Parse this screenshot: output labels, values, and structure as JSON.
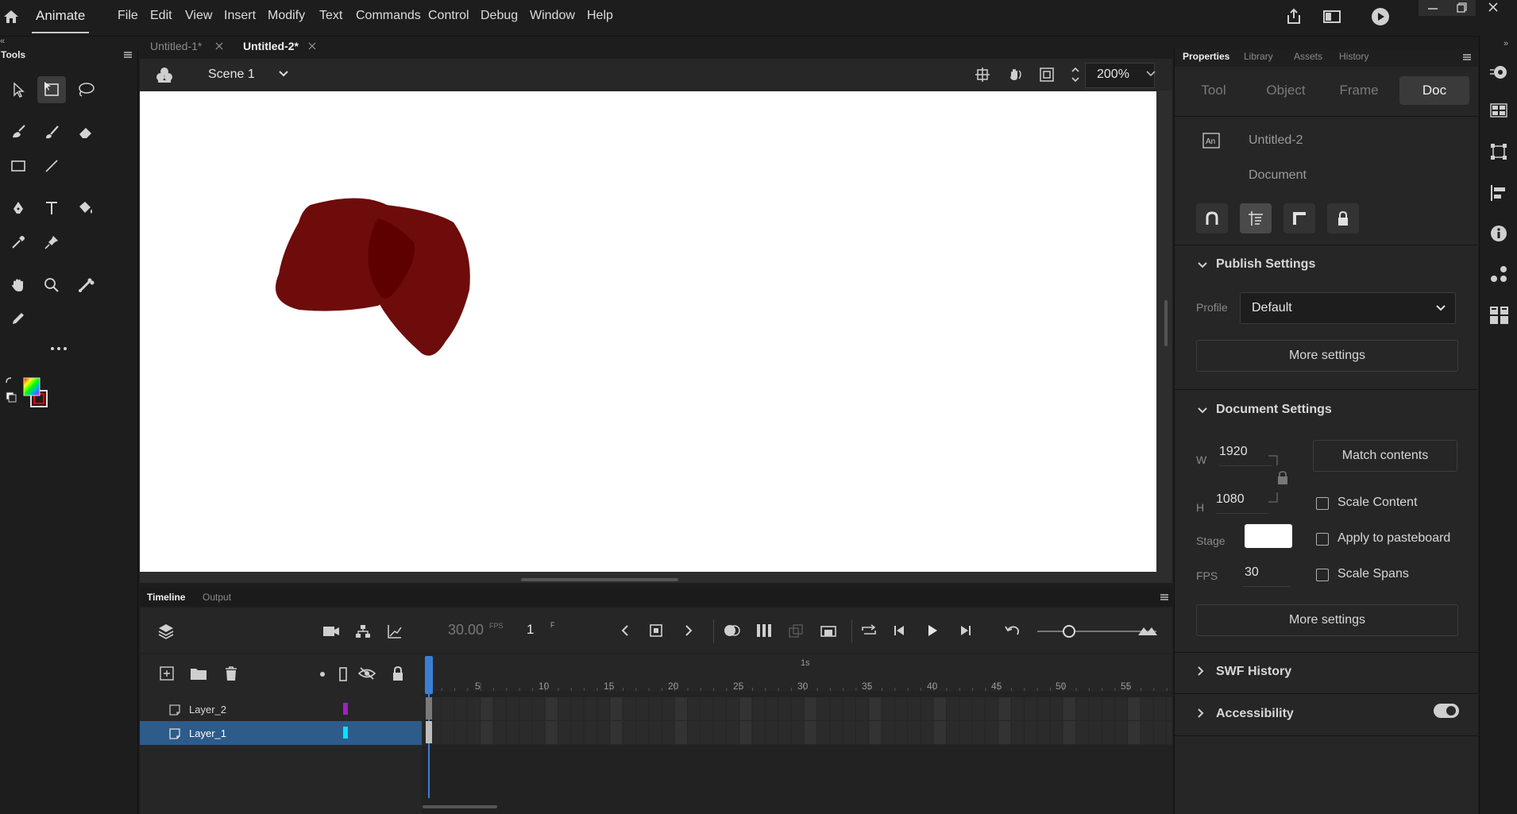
{
  "app": {
    "name": "Animate"
  },
  "menu": [
    "File",
    "Edit",
    "View",
    "Insert",
    "Modify",
    "Text",
    "Commands",
    "Control",
    "Debug",
    "Window",
    "Help"
  ],
  "doc_tabs": [
    {
      "label": "Untitled-1*",
      "active": false
    },
    {
      "label": "Untitled-2*",
      "active": true
    }
  ],
  "tools_panel": {
    "title": "Tools"
  },
  "scene": {
    "label": "Scene 1",
    "zoom": "200%"
  },
  "timeline": {
    "tabs": [
      "Timeline",
      "Output"
    ],
    "fps_value": "30.00",
    "fps_unit": "FPS",
    "frame_value": "1",
    "frame_unit": "F",
    "ruler_second": "1s",
    "ruler_ticks": [
      "5",
      "10",
      "15",
      "20",
      "25",
      "30",
      "35",
      "40",
      "45",
      "50",
      "55"
    ],
    "layers": [
      {
        "name": "Layer_2",
        "color": "#a020c0",
        "selected": false
      },
      {
        "name": "Layer_1",
        "color": "#00e5ff",
        "selected": true
      }
    ]
  },
  "properties": {
    "tabs": [
      "Properties",
      "Library",
      "Assets",
      "History"
    ],
    "segments": [
      "Tool",
      "Object",
      "Frame",
      "Doc"
    ],
    "doc_name": "Untitled-2",
    "doc_type": "Document",
    "publish": {
      "title": "Publish Settings",
      "profile_label": "Profile",
      "profile_value": "Default",
      "more": "More settings"
    },
    "document": {
      "title": "Document Settings",
      "w_label": "W",
      "w_value": "1920",
      "h_label": "H",
      "h_value": "1080",
      "match": "Match contents",
      "scale_content": "Scale Content",
      "apply_pasteboard": "Apply to pasteboard",
      "scale_spans": "Scale Spans",
      "stage_label": "Stage",
      "fps_label": "FPS",
      "fps_value": "30",
      "more": "More settings"
    },
    "swf_history": "SWF History",
    "accessibility": "Accessibility"
  },
  "colors": {
    "selection": "#2d5b8a",
    "shape": "#6e0b0b",
    "shape_overlap": "#5f0000"
  }
}
